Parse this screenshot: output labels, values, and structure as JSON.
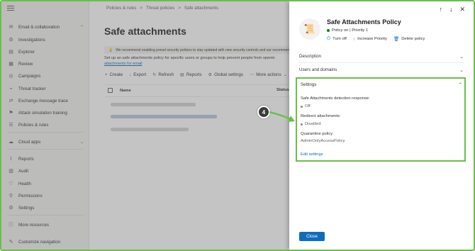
{
  "nav": {
    "items": [
      {
        "label": "Email & collaboration",
        "icon": "mail-icon",
        "expanded": true
      },
      {
        "label": "Investigations",
        "icon": "investigation-icon"
      },
      {
        "label": "Explorer",
        "icon": "explorer-icon"
      },
      {
        "label": "Review",
        "icon": "review-icon"
      },
      {
        "label": "Campaigns",
        "icon": "campaigns-icon"
      },
      {
        "label": "Threat tracker",
        "icon": "threat-tracker-icon"
      },
      {
        "label": "Exchange message trace",
        "icon": "message-trace-icon"
      },
      {
        "label": "Attack simulation training",
        "icon": "simulation-icon"
      },
      {
        "label": "Policies & rules",
        "icon": "policies-icon"
      },
      {
        "label": "Cloud apps",
        "icon": "cloud-icon",
        "expanded": false
      },
      {
        "label": "Reports",
        "icon": "reports-icon"
      },
      {
        "label": "Audit",
        "icon": "audit-icon"
      },
      {
        "label": "Health",
        "icon": "health-icon"
      },
      {
        "label": "Permissions",
        "icon": "permissions-icon"
      },
      {
        "label": "Settings",
        "icon": "settings-icon"
      },
      {
        "label": "More resources",
        "icon": "info-icon"
      },
      {
        "label": "Customize navigation",
        "icon": "edit-icon"
      }
    ]
  },
  "main": {
    "breadcrumb": [
      "Policies & rules",
      ">",
      "Threat policies",
      ">",
      "Safe attachments"
    ],
    "title": "Safe attachments",
    "info_text": "We recommend enabling preset security policies to stay updated with new security controls and our recommen",
    "description": "Set up an safe attachments policy for specific users or groups to help prevent people from openin",
    "description_link": "attachments for email",
    "toolbar": [
      "Create",
      "Export",
      "Refresh",
      "Reports",
      "Global settings",
      "More actions"
    ],
    "columns": [
      "Name",
      "Status"
    ]
  },
  "panel": {
    "title": "Safe Attachments Policy",
    "status": "Policy on | Priority 1",
    "actions": [
      "Turn off",
      "Increase Priority",
      "Delete policy"
    ],
    "sections": [
      "Description",
      "Users and domains"
    ],
    "settings": {
      "header": "Settings",
      "detection_label": "Safe Attachments detection response:",
      "detection_value": "Off",
      "redirect_label": "Redirect attachments:",
      "redirect_value": "Disabled",
      "quarantine_label": "Quarantine policy",
      "quarantine_value": "AdminOnlyAccessPolicy",
      "edit_link": "Edit settings"
    },
    "close_label": "Close"
  },
  "callout_number": "4",
  "colors": {
    "accent": "#0f6cbd",
    "highlight": "#6abf4b",
    "status_on": "#107c10"
  }
}
